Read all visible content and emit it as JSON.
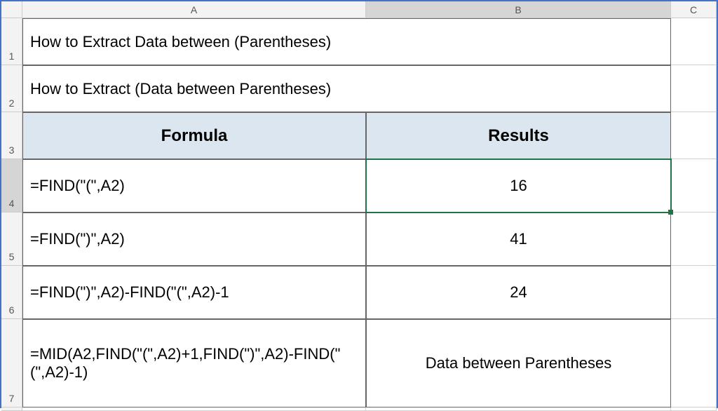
{
  "columns": [
    "A",
    "B",
    "C"
  ],
  "rows": [
    "1",
    "2",
    "3",
    "4",
    "5",
    "6",
    "7"
  ],
  "title1": "How to Extract Data between (Parentheses)",
  "title2": "How to Extract (Data between Parentheses)",
  "header": {
    "a": "Formula",
    "b": "Results"
  },
  "r4": {
    "a": "=FIND(\"(\",A2)",
    "b": "16"
  },
  "r5": {
    "a": "=FIND(\")\",A2)",
    "b": "41"
  },
  "r6": {
    "a": "=FIND(\")\",A2)-FIND(\"(\",A2)-1",
    "b": "24"
  },
  "r7": {
    "a": "=MID(A2,FIND(\"(\",A2)+1,FIND(\")\",A2)-FIND(\"(\",A2)-1)",
    "b": "Data between Parentheses"
  },
  "selected_cell": "B4"
}
